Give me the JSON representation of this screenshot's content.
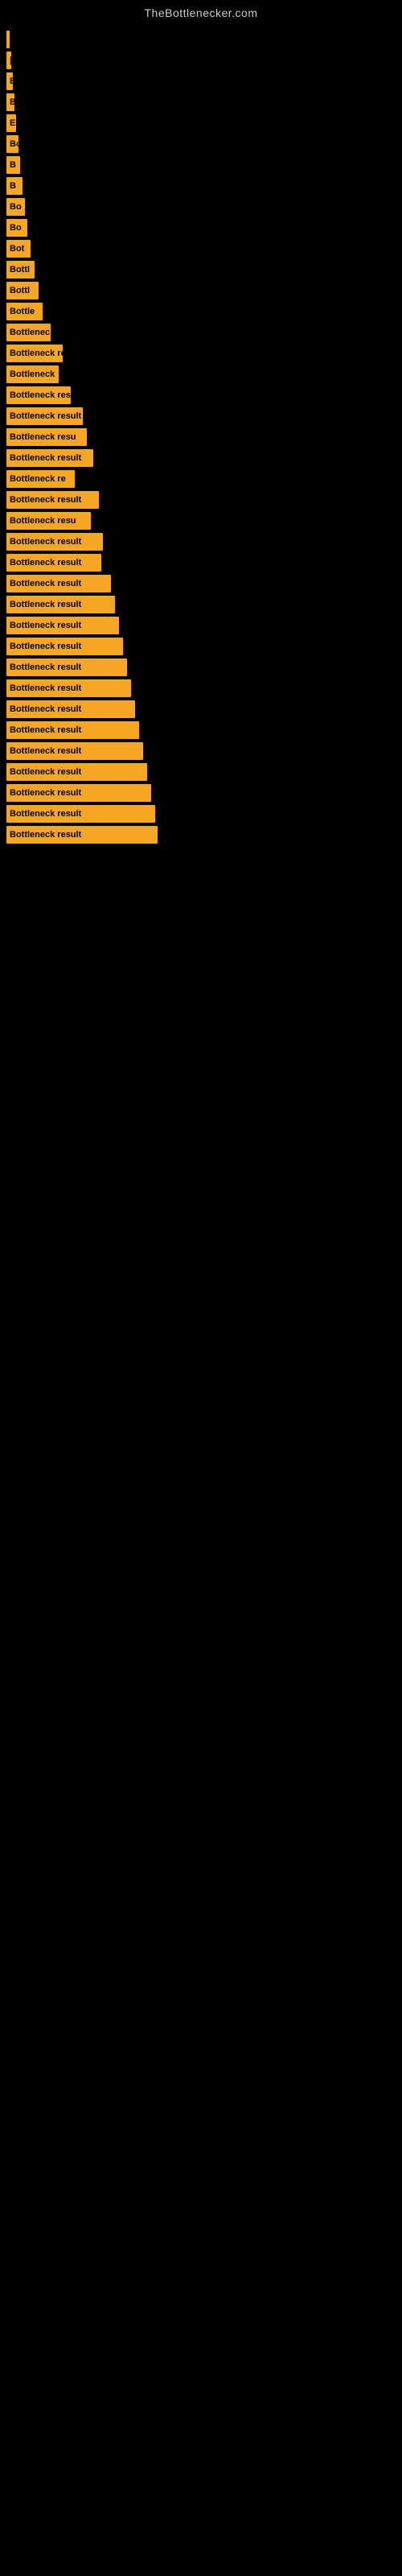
{
  "site": {
    "title": "TheBottlenecker.com"
  },
  "bars": [
    {
      "width": 4,
      "label": "|"
    },
    {
      "width": 6,
      "label": "|"
    },
    {
      "width": 8,
      "label": "E"
    },
    {
      "width": 10,
      "label": "B"
    },
    {
      "width": 12,
      "label": "E"
    },
    {
      "width": 15,
      "label": "Bo"
    },
    {
      "width": 17,
      "label": "B"
    },
    {
      "width": 20,
      "label": "B"
    },
    {
      "width": 23,
      "label": "Bo"
    },
    {
      "width": 26,
      "label": "Bo"
    },
    {
      "width": 30,
      "label": "Bot"
    },
    {
      "width": 35,
      "label": "Bottl"
    },
    {
      "width": 40,
      "label": "Bottl"
    },
    {
      "width": 45,
      "label": "Bottle"
    },
    {
      "width": 55,
      "label": "Bottlenec"
    },
    {
      "width": 70,
      "label": "Bottleneck res"
    },
    {
      "width": 65,
      "label": "Bottleneck"
    },
    {
      "width": 80,
      "label": "Bottleneck resu"
    },
    {
      "width": 95,
      "label": "Bottleneck result"
    },
    {
      "width": 100,
      "label": "Bottleneck resu"
    },
    {
      "width": 108,
      "label": "Bottleneck result"
    },
    {
      "width": 85,
      "label": "Bottleneck re"
    },
    {
      "width": 115,
      "label": "Bottleneck result"
    },
    {
      "width": 105,
      "label": "Bottleneck resu"
    },
    {
      "width": 120,
      "label": "Bottleneck result"
    },
    {
      "width": 118,
      "label": "Bottleneck result"
    },
    {
      "width": 130,
      "label": "Bottleneck result"
    },
    {
      "width": 135,
      "label": "Bottleneck result"
    },
    {
      "width": 140,
      "label": "Bottleneck result"
    },
    {
      "width": 145,
      "label": "Bottleneck result"
    },
    {
      "width": 150,
      "label": "Bottleneck result"
    },
    {
      "width": 155,
      "label": "Bottleneck result"
    },
    {
      "width": 160,
      "label": "Bottleneck result"
    },
    {
      "width": 165,
      "label": "Bottleneck result"
    },
    {
      "width": 170,
      "label": "Bottleneck result"
    },
    {
      "width": 175,
      "label": "Bottleneck result"
    },
    {
      "width": 180,
      "label": "Bottleneck result"
    },
    {
      "width": 185,
      "label": "Bottleneck result"
    },
    {
      "width": 188,
      "label": "Bottleneck result"
    }
  ]
}
